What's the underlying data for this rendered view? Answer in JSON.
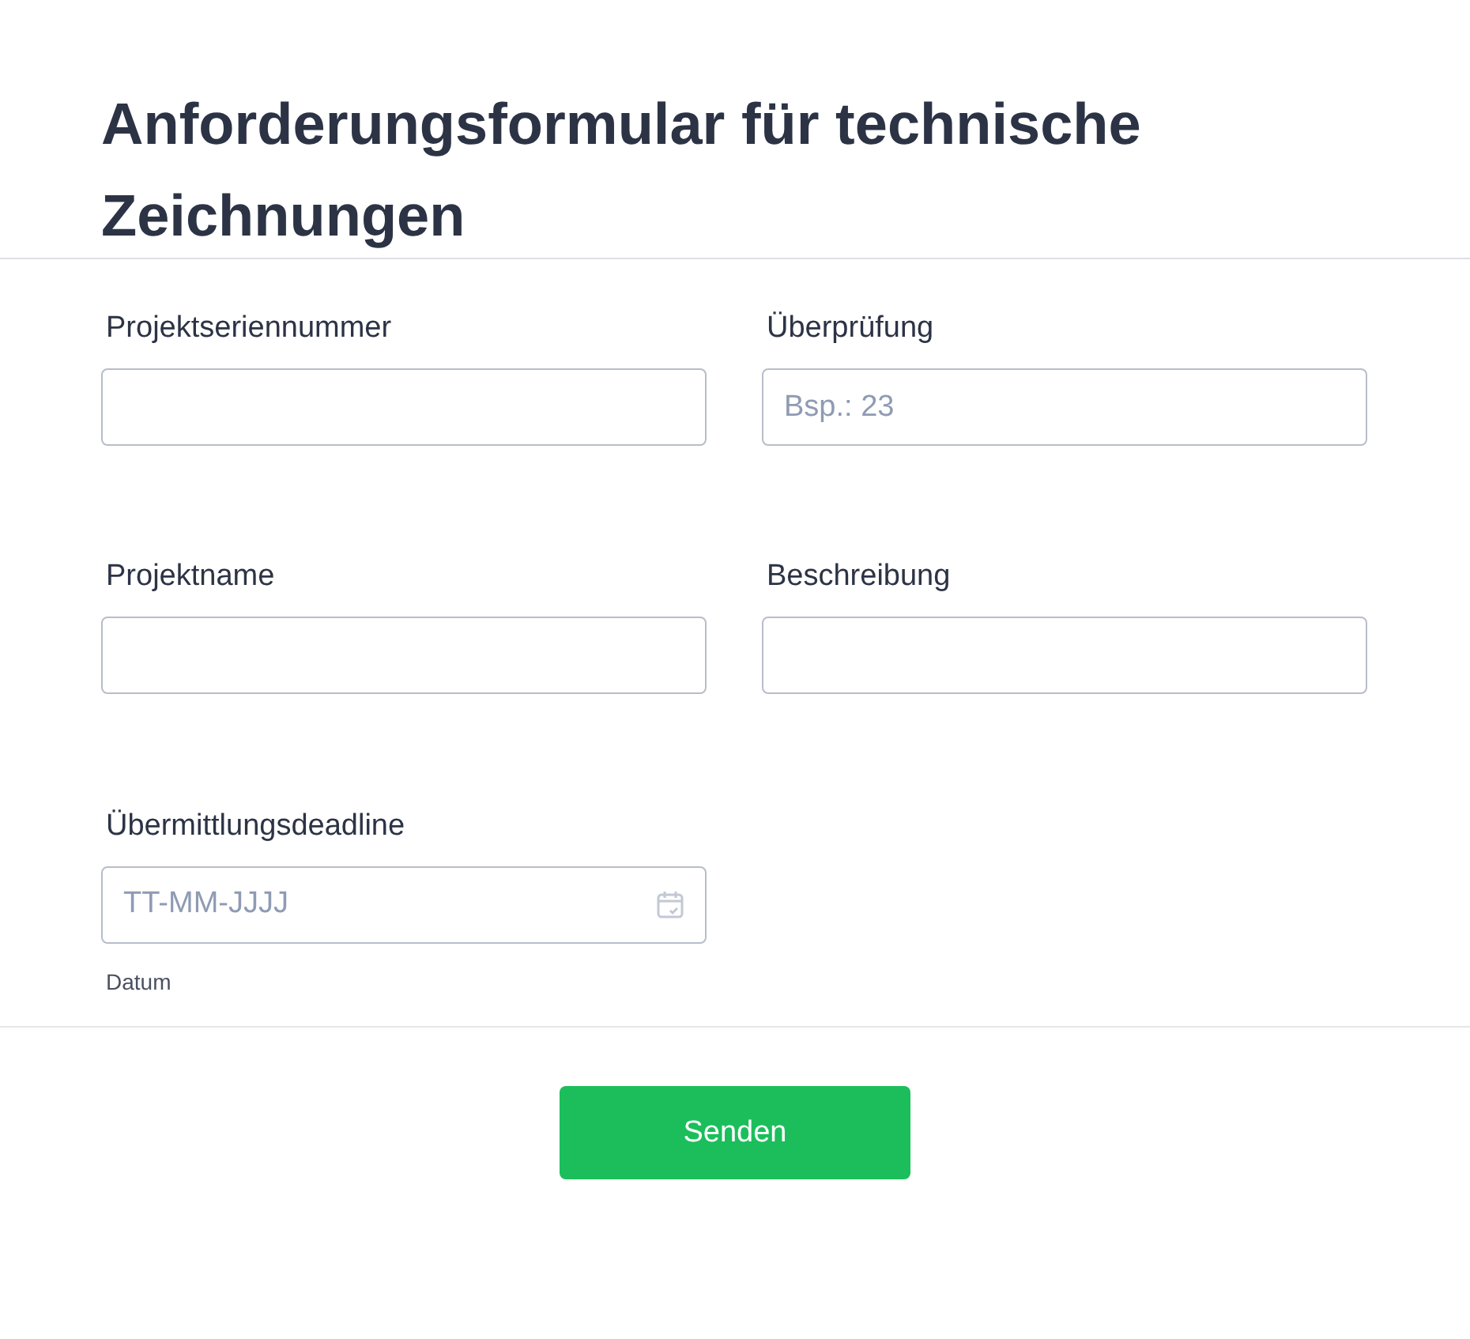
{
  "title": "Anforderungsformular für technische Zeichnungen",
  "fields": [
    {
      "kind": "text",
      "label": "Projektseriennummer"
    },
    {
      "kind": "text",
      "label": "Überprüfung",
      "placeholder": "Bsp.: 23"
    },
    {
      "kind": "text",
      "label": "Projektname"
    },
    {
      "kind": "text",
      "label": "Beschreibung"
    },
    {
      "kind": "date",
      "label": "Übermittlungsdeadline",
      "placeholder": "TT-MM-JJJJ",
      "hint": "Datum"
    }
  ],
  "submit": {
    "label": "Senden"
  }
}
